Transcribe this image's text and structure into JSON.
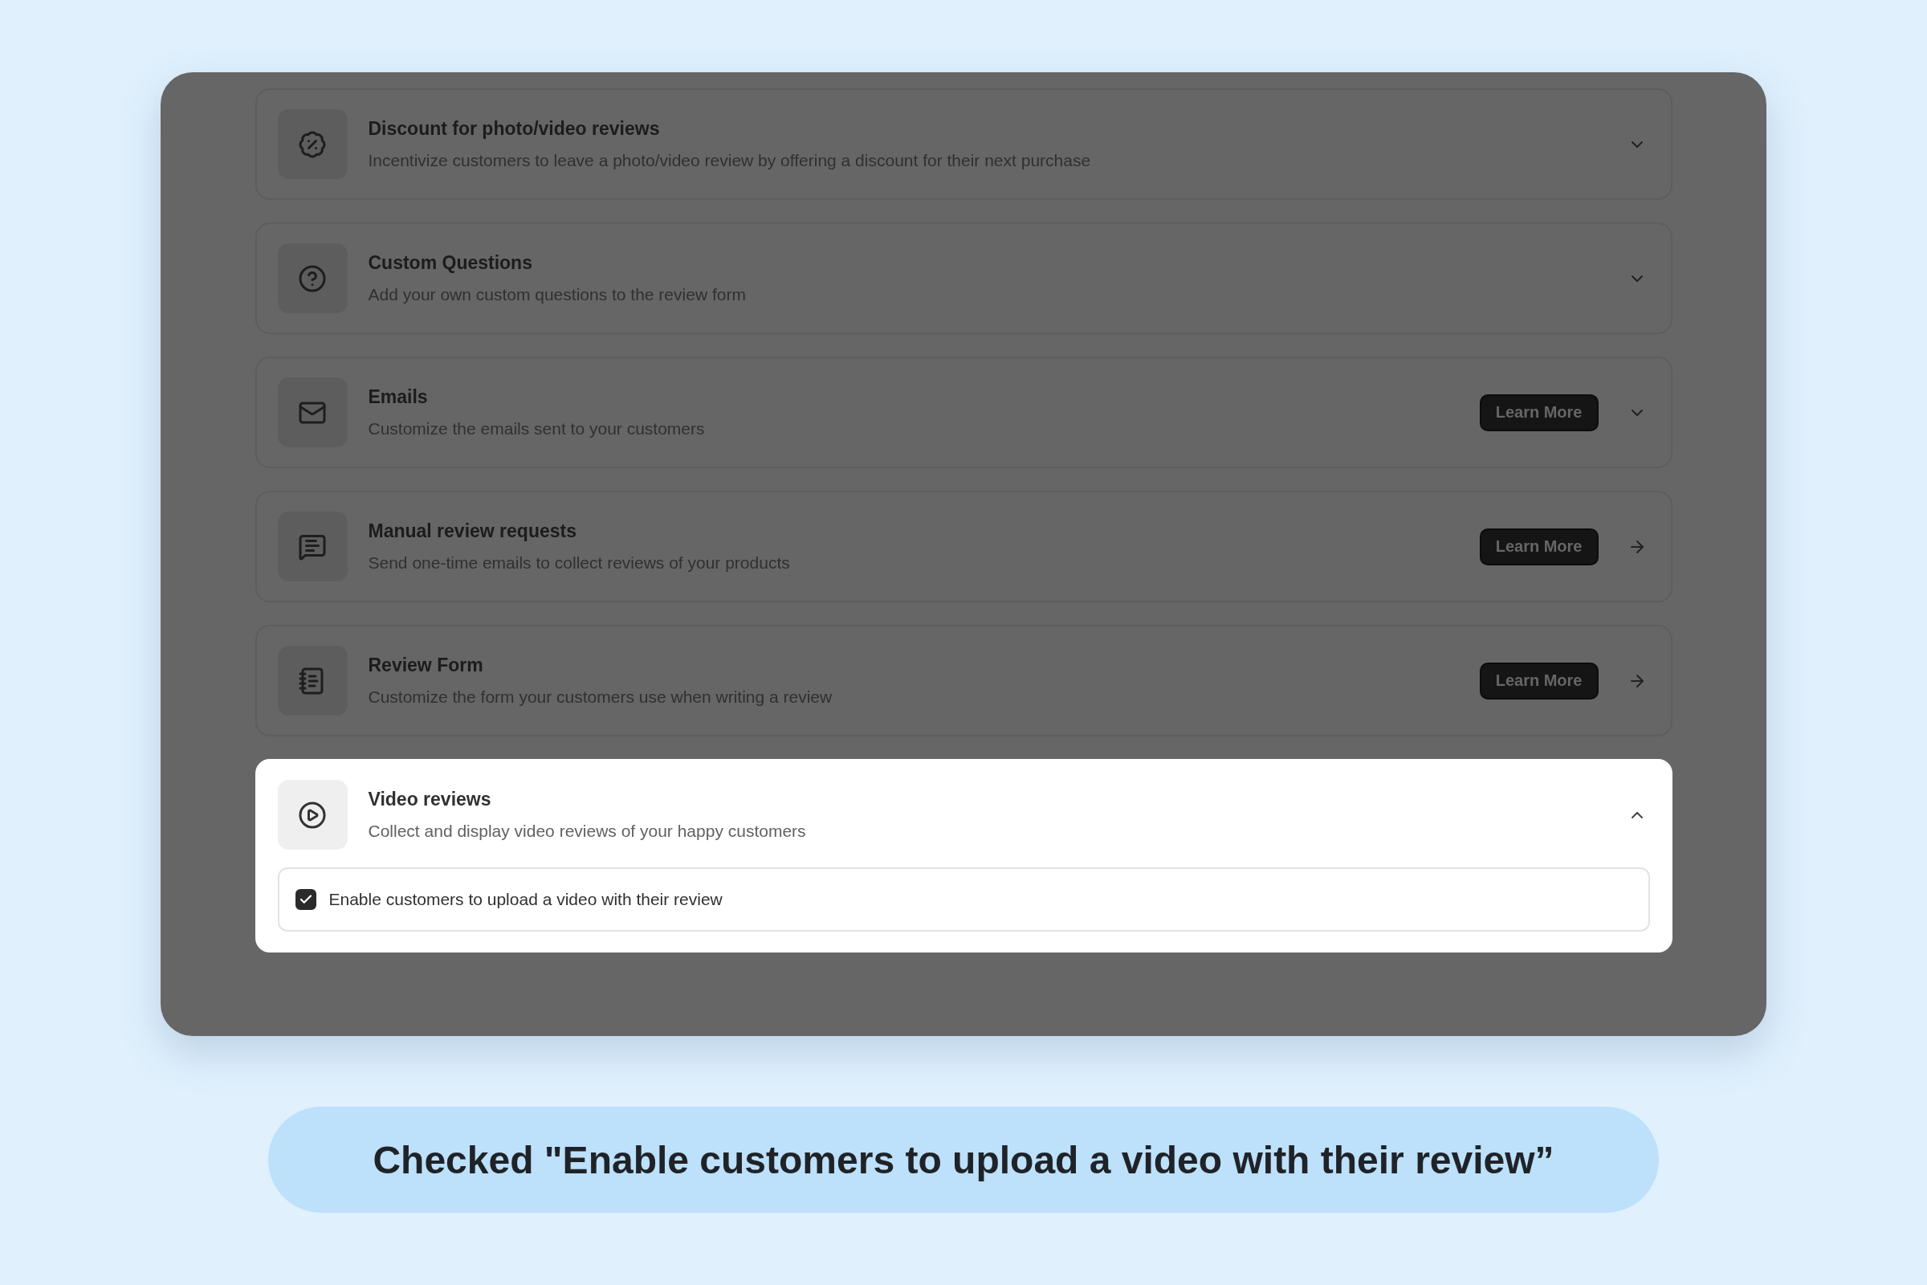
{
  "cards": [
    {
      "title": "Discount for photo/video reviews",
      "description": "Incentivize customers to leave a photo/video review by offering a discount for their next purchase",
      "kind": "chevron",
      "expanded": false
    },
    {
      "title": "Custom Questions",
      "description": "Add your own custom questions to the review form",
      "kind": "chevron",
      "expanded": false
    },
    {
      "title": "Emails",
      "description": "Customize the emails sent to your customers",
      "button": "Learn More",
      "kind": "chevron",
      "expanded": false
    },
    {
      "title": "Manual review requests",
      "description": "Send one-time emails to collect reviews of your products",
      "button": "Learn More",
      "kind": "arrow",
      "expanded": false
    },
    {
      "title": "Review Form",
      "description": "Customize the form your customers use when writing a review",
      "button": "Learn More",
      "kind": "arrow",
      "expanded": false
    },
    {
      "title": "Video reviews",
      "description": "Collect and display video reviews of your happy customers",
      "kind": "chevron",
      "expanded": true,
      "option": {
        "label": "Enable customers to upload a video with their review",
        "checked": true
      }
    }
  ],
  "caption": "Checked \"Enable customers to upload a video with their review”"
}
